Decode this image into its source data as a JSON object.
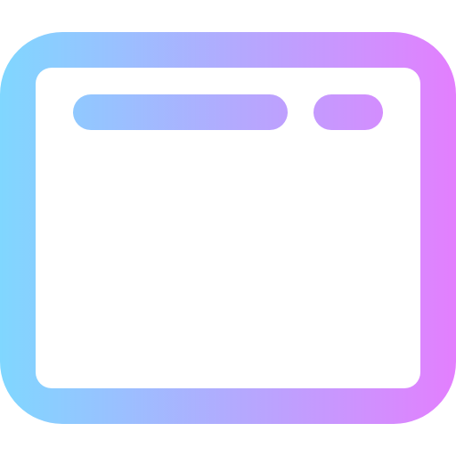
{
  "icon": {
    "name": "browser-window-icon",
    "gradient": {
      "start": "#80d7ff",
      "end": "#e37ffe"
    },
    "background": "#ffffff"
  }
}
